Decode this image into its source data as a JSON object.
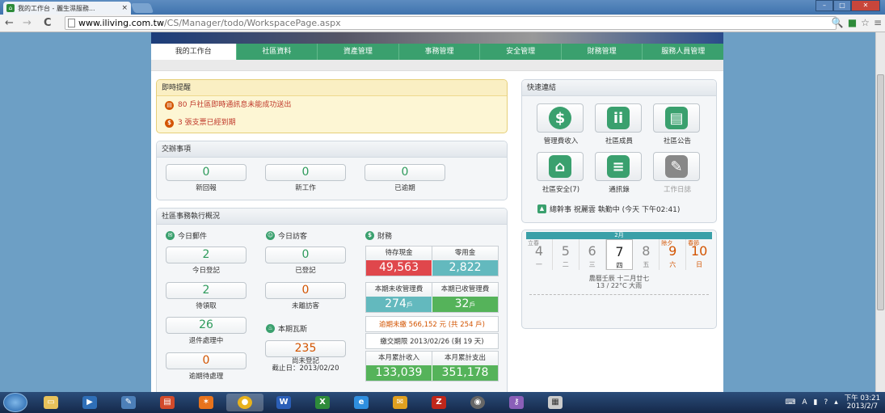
{
  "browser": {
    "tab_title": "我的工作台 - 麗生濕服務...",
    "tab_close": "×",
    "url_host": "www.iliving.com.tw",
    "url_path": "/CS/Manager/todo/WorkspacePage.aspx",
    "nav_back": "←",
    "nav_forward": "→",
    "nav_reload": "C"
  },
  "nav": {
    "tabs": [
      "我的工作台",
      "社區資料",
      "資產管理",
      "事務管理",
      "安全管理",
      "財務管理",
      "服務人員管理"
    ]
  },
  "alerts": {
    "title": "即時提醒",
    "items": [
      "80 戶社區即時通訊息未能成功送出",
      "3 張支票已經到期"
    ]
  },
  "handover": {
    "title": "交辦事項",
    "stats": [
      {
        "value": "0",
        "label": "新回報"
      },
      {
        "value": "0",
        "label": "新工作"
      },
      {
        "value": "0",
        "label": "已逾期"
      }
    ]
  },
  "overview": {
    "title": "社區事務執行概況",
    "mail": {
      "title": "今日郵件",
      "stats": [
        {
          "value": "2",
          "label": "今日登記"
        },
        {
          "value": "2",
          "label": "待領取"
        },
        {
          "value": "26",
          "label": "退件處理中"
        },
        {
          "value": "0",
          "label": "逾期待處理"
        }
      ]
    },
    "visitors": {
      "title": "今日訪客",
      "stats": [
        {
          "value": "0",
          "label": "已登記"
        },
        {
          "value": "0",
          "label": "未離訪客"
        }
      ]
    },
    "gas": {
      "title": "本期瓦斯",
      "value": "235",
      "label": "尚未登記",
      "deadline": "截止日：2013/02/20"
    },
    "finance": {
      "title": "財務",
      "cash_headers": [
        "待存現金",
        "零用金"
      ],
      "cash_values": [
        "49,563",
        "2,822"
      ],
      "fee_headers": [
        "本期未收管理費",
        "本期已收管理費"
      ],
      "fee_values": [
        "274",
        "32"
      ],
      "fee_unit": "戶",
      "overdue": "逾期未繳 566,152 元 (共 254 戶)",
      "payment_deadline": "繳交期限 2013/02/26 (剩 19 天)",
      "month_headers": [
        "本月累計收入",
        "本月累計支出"
      ],
      "month_values": [
        "133,039",
        "351,178"
      ]
    }
  },
  "quicklinks": {
    "title": "快速連結",
    "items": [
      {
        "label": "管理費收入",
        "icon": "dollar-icon",
        "glyph": "$"
      },
      {
        "label": "社區成員",
        "icon": "members-icon",
        "glyph": "ii"
      },
      {
        "label": "社區公告",
        "icon": "notice-board-icon",
        "glyph": "▤"
      },
      {
        "label": "社區安全(7)",
        "icon": "home-security-icon",
        "glyph": "⌂"
      },
      {
        "label": "通訊錄",
        "icon": "address-book-icon",
        "glyph": "≡"
      },
      {
        "label": "工作日誌",
        "icon": "work-log-icon",
        "glyph": "✎"
      }
    ],
    "duty": "總幹事 祝麗雲 執勤中 (今天 下午02:41)"
  },
  "calendar": {
    "month": "2月",
    "days": [
      {
        "num": "4",
        "week": "一",
        "tag": "立春"
      },
      {
        "num": "5",
        "week": "二",
        "tag": ""
      },
      {
        "num": "6",
        "week": "三",
        "tag": ""
      },
      {
        "num": "7",
        "week": "四",
        "tag": ""
      },
      {
        "num": "8",
        "week": "五",
        "tag": ""
      },
      {
        "num": "9",
        "week": "六",
        "tag": "除夕"
      },
      {
        "num": "10",
        "week": "日",
        "tag": "春節"
      }
    ],
    "lunar": "農曆壬辰 十二月廿七",
    "weather": "13 / 22°C 大雨"
  },
  "taskbar": {
    "tray_text": "A",
    "time": "下午 03:21",
    "date": "2013/2/7"
  },
  "colors": {
    "accent": "#3aa06e",
    "alert": "#d35400",
    "cash_red": "#e0474c",
    "teal": "#63b9be",
    "green": "#55b35a"
  }
}
